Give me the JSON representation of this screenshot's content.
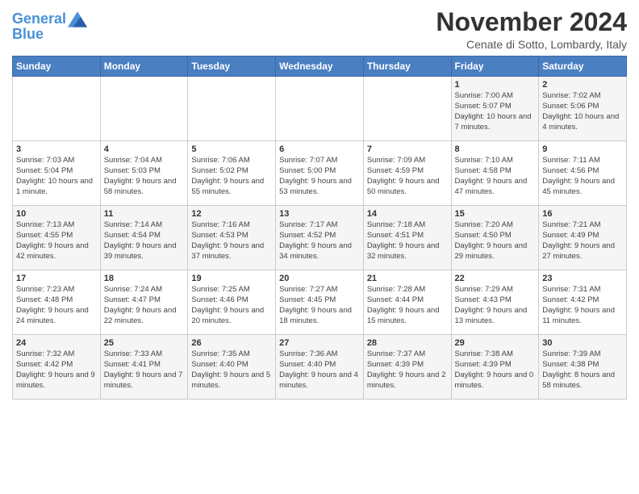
{
  "logo": {
    "line1": "General",
    "line2": "Blue"
  },
  "title": "November 2024",
  "location": "Cenate di Sotto, Lombardy, Italy",
  "days_of_week": [
    "Sunday",
    "Monday",
    "Tuesday",
    "Wednesday",
    "Thursday",
    "Friday",
    "Saturday"
  ],
  "weeks": [
    [
      {
        "day": "",
        "info": ""
      },
      {
        "day": "",
        "info": ""
      },
      {
        "day": "",
        "info": ""
      },
      {
        "day": "",
        "info": ""
      },
      {
        "day": "",
        "info": ""
      },
      {
        "day": "1",
        "info": "Sunrise: 7:00 AM\nSunset: 5:07 PM\nDaylight: 10 hours and 7 minutes."
      },
      {
        "day": "2",
        "info": "Sunrise: 7:02 AM\nSunset: 5:06 PM\nDaylight: 10 hours and 4 minutes."
      }
    ],
    [
      {
        "day": "3",
        "info": "Sunrise: 7:03 AM\nSunset: 5:04 PM\nDaylight: 10 hours and 1 minute."
      },
      {
        "day": "4",
        "info": "Sunrise: 7:04 AM\nSunset: 5:03 PM\nDaylight: 9 hours and 58 minutes."
      },
      {
        "day": "5",
        "info": "Sunrise: 7:06 AM\nSunset: 5:02 PM\nDaylight: 9 hours and 55 minutes."
      },
      {
        "day": "6",
        "info": "Sunrise: 7:07 AM\nSunset: 5:00 PM\nDaylight: 9 hours and 53 minutes."
      },
      {
        "day": "7",
        "info": "Sunrise: 7:09 AM\nSunset: 4:59 PM\nDaylight: 9 hours and 50 minutes."
      },
      {
        "day": "8",
        "info": "Sunrise: 7:10 AM\nSunset: 4:58 PM\nDaylight: 9 hours and 47 minutes."
      },
      {
        "day": "9",
        "info": "Sunrise: 7:11 AM\nSunset: 4:56 PM\nDaylight: 9 hours and 45 minutes."
      }
    ],
    [
      {
        "day": "10",
        "info": "Sunrise: 7:13 AM\nSunset: 4:55 PM\nDaylight: 9 hours and 42 minutes."
      },
      {
        "day": "11",
        "info": "Sunrise: 7:14 AM\nSunset: 4:54 PM\nDaylight: 9 hours and 39 minutes."
      },
      {
        "day": "12",
        "info": "Sunrise: 7:16 AM\nSunset: 4:53 PM\nDaylight: 9 hours and 37 minutes."
      },
      {
        "day": "13",
        "info": "Sunrise: 7:17 AM\nSunset: 4:52 PM\nDaylight: 9 hours and 34 minutes."
      },
      {
        "day": "14",
        "info": "Sunrise: 7:18 AM\nSunset: 4:51 PM\nDaylight: 9 hours and 32 minutes."
      },
      {
        "day": "15",
        "info": "Sunrise: 7:20 AM\nSunset: 4:50 PM\nDaylight: 9 hours and 29 minutes."
      },
      {
        "day": "16",
        "info": "Sunrise: 7:21 AM\nSunset: 4:49 PM\nDaylight: 9 hours and 27 minutes."
      }
    ],
    [
      {
        "day": "17",
        "info": "Sunrise: 7:23 AM\nSunset: 4:48 PM\nDaylight: 9 hours and 24 minutes."
      },
      {
        "day": "18",
        "info": "Sunrise: 7:24 AM\nSunset: 4:47 PM\nDaylight: 9 hours and 22 minutes."
      },
      {
        "day": "19",
        "info": "Sunrise: 7:25 AM\nSunset: 4:46 PM\nDaylight: 9 hours and 20 minutes."
      },
      {
        "day": "20",
        "info": "Sunrise: 7:27 AM\nSunset: 4:45 PM\nDaylight: 9 hours and 18 minutes."
      },
      {
        "day": "21",
        "info": "Sunrise: 7:28 AM\nSunset: 4:44 PM\nDaylight: 9 hours and 15 minutes."
      },
      {
        "day": "22",
        "info": "Sunrise: 7:29 AM\nSunset: 4:43 PM\nDaylight: 9 hours and 13 minutes."
      },
      {
        "day": "23",
        "info": "Sunrise: 7:31 AM\nSunset: 4:42 PM\nDaylight: 9 hours and 11 minutes."
      }
    ],
    [
      {
        "day": "24",
        "info": "Sunrise: 7:32 AM\nSunset: 4:42 PM\nDaylight: 9 hours and 9 minutes."
      },
      {
        "day": "25",
        "info": "Sunrise: 7:33 AM\nSunset: 4:41 PM\nDaylight: 9 hours and 7 minutes."
      },
      {
        "day": "26",
        "info": "Sunrise: 7:35 AM\nSunset: 4:40 PM\nDaylight: 9 hours and 5 minutes."
      },
      {
        "day": "27",
        "info": "Sunrise: 7:36 AM\nSunset: 4:40 PM\nDaylight: 9 hours and 4 minutes."
      },
      {
        "day": "28",
        "info": "Sunrise: 7:37 AM\nSunset: 4:39 PM\nDaylight: 9 hours and 2 minutes."
      },
      {
        "day": "29",
        "info": "Sunrise: 7:38 AM\nSunset: 4:39 PM\nDaylight: 9 hours and 0 minutes."
      },
      {
        "day": "30",
        "info": "Sunrise: 7:39 AM\nSunset: 4:38 PM\nDaylight: 8 hours and 58 minutes."
      }
    ]
  ]
}
